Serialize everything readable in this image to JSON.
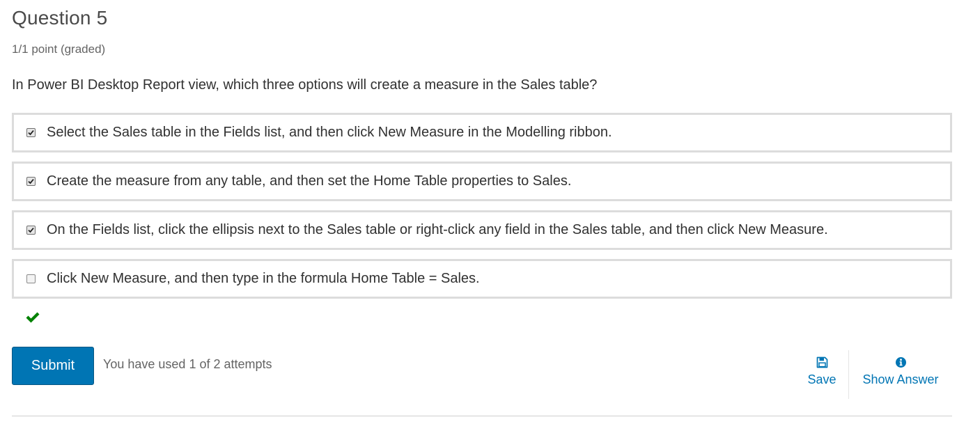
{
  "question": {
    "title": "Question 5",
    "points": "1/1 point (graded)",
    "prompt": "In Power BI Desktop Report view, which three options will create a measure in the Sales table?"
  },
  "choices": [
    {
      "label": "Select the Sales table in the Fields list, and then click New Measure in the Modelling ribbon.",
      "checked": true
    },
    {
      "label": "Create the measure from any table, and then set the Home Table properties to Sales.",
      "checked": true
    },
    {
      "label": "On the Fields list, click the ellipsis next to the Sales table or right-click any field in the Sales table, and then click New Measure.",
      "checked": true
    },
    {
      "label": "Click New Measure, and then type in the formula Home Table = Sales.",
      "checked": false
    }
  ],
  "status": {
    "icon": "checkmark-icon",
    "state": "correct",
    "color": "#008100"
  },
  "actions": {
    "submit_label": "Submit",
    "attempts_text": "You have used 1 of 2 attempts",
    "save_label": "Save",
    "save_icon": "floppy-disk-icon",
    "show_answer_label": "Show Answer",
    "show_answer_icon": "info-circle-icon"
  },
  "colors": {
    "accent": "#0075b4",
    "border": "#dcdcdc",
    "text": "#313131",
    "muted": "#646464"
  }
}
